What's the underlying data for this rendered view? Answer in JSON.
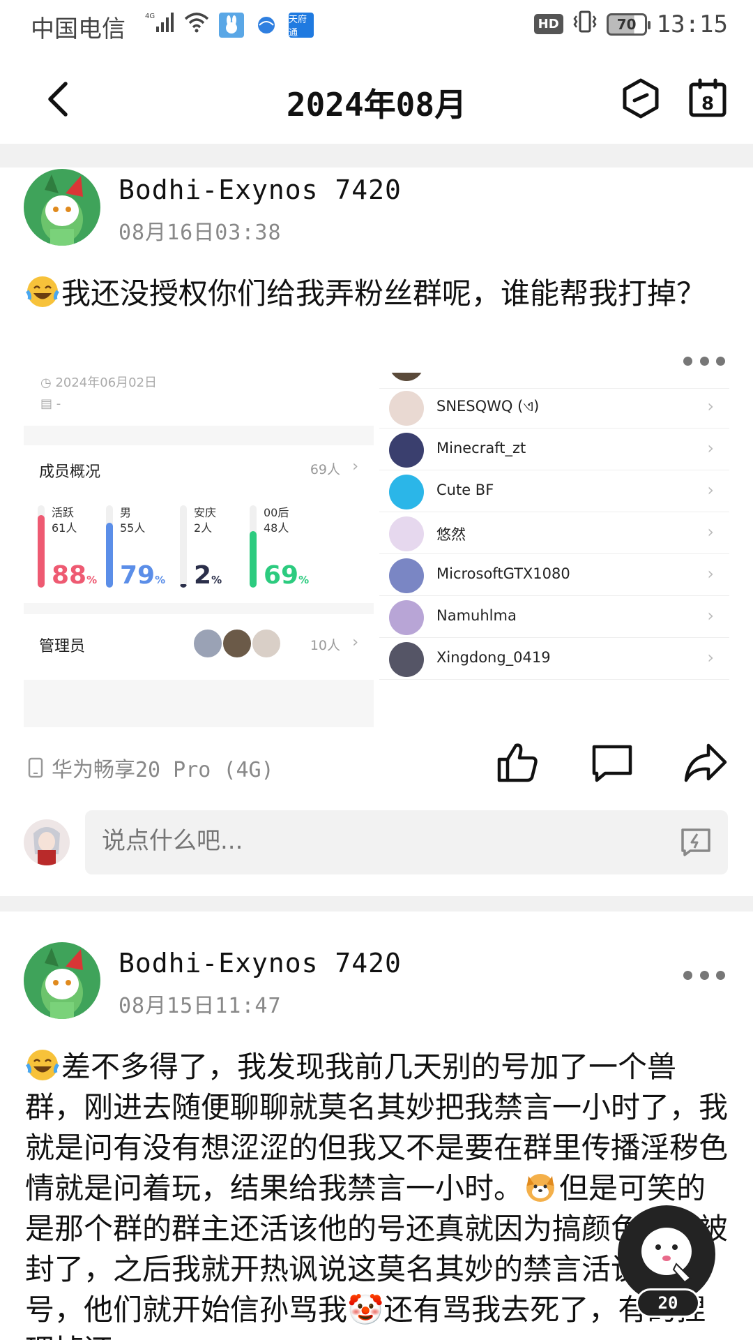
{
  "status_bar": {
    "carrier": "中国电信",
    "network": "4G",
    "app_badge_text": "天府通",
    "hd": "HD",
    "battery": "70",
    "time": "13:15"
  },
  "header": {
    "title": "2024年08月",
    "calendar_day": "8"
  },
  "posts": [
    {
      "author": "Bodhi-Exynos 7420",
      "time": "08月16日03:38",
      "text": "我还没授权你们给我弄粉丝群呢，谁能帮我打掉？",
      "device": "华为畅享20 Pro (4G)",
      "images": {
        "left": {
          "date": "2024年06月02日",
          "desc": "-",
          "members_title": "成员概况",
          "members_count": "69人",
          "stats": [
            {
              "label": "活跃",
              "sub": "61人",
              "pct": "88",
              "unit": "%",
              "value": 88,
              "color": "#ee5a72"
            },
            {
              "label": "男",
              "sub": "55人",
              "pct": "79",
              "unit": "%",
              "value": 79,
              "color": "#5b8ee8"
            },
            {
              "label": "安庆",
              "sub": "2人",
              "pct": "2",
              "unit": "%",
              "value": 2,
              "color": "#2b2f4a"
            },
            {
              "label": "00后",
              "sub": "48人",
              "pct": "69",
              "unit": "%",
              "value": 69,
              "color": "#2ccb7f"
            }
          ],
          "admins_title": "管理员",
          "admins_count": "10人"
        },
        "right": {
          "members": [
            {
              "name": "SNESQWQ (ଏ)",
              "color": "#e9d9d2"
            },
            {
              "name": "Minecraft_zt",
              "color": "#3a3f6e"
            },
            {
              "name": "Cute BF",
              "color": "#2bb6e8"
            },
            {
              "name": "悠然",
              "color": "#e6d8ee"
            },
            {
              "name": "MicrosoftGTX1080",
              "color": "#7a86c4"
            },
            {
              "name": "Namuhlma",
              "color": "#b8a5d6"
            },
            {
              "name": "Xingdong_0419",
              "color": "#556"
            }
          ]
        }
      }
    },
    {
      "author": "Bodhi-Exynos 7420",
      "time": "08月15日11:47",
      "text_part1": "差不多得了，我发现我前几天别的号加了一个兽群，刚进去随便聊聊就莫名其妙把我禁言一小时了，我就是问有没有想涩涩的但我又不是要在群里传播淫秽色情就是问着玩，结果给我禁言一小时。",
      "text_part2": "但是可笑的是那个群的群主还活该他的号还真就因为搞颜色然后被封了，之后我就开热讽说这莫名其妙的禁言活该被封号，他们就开始信孙骂我🤡还有骂我去死了，有的捏理掉还"
    }
  ],
  "comment": {
    "placeholder": "说点什么吧..."
  },
  "float": {
    "badge": "20"
  }
}
